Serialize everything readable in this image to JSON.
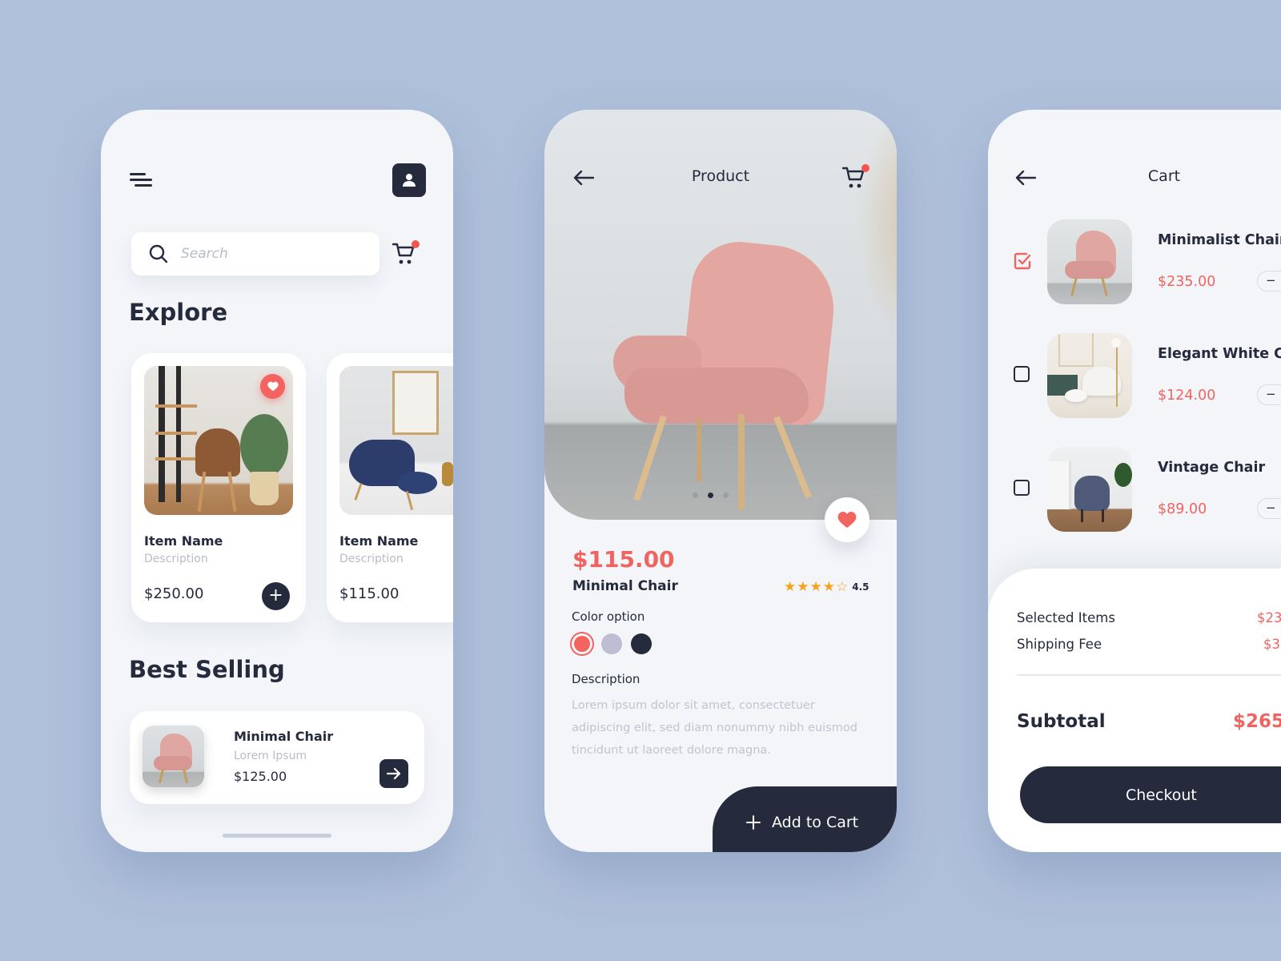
{
  "theme": {
    "background": "#afc0da",
    "screen": "#f3f5f9",
    "dark": "#252a3d",
    "accent": "#ef6461",
    "star": "#f6a31a"
  },
  "explore_screen": {
    "search": {
      "placeholder": "Search",
      "value": ""
    },
    "cart_has_badge": true,
    "explore_title": "Explore",
    "items": [
      {
        "name": "Item Name",
        "description": "Description",
        "price": "$250.00",
        "favorited": true,
        "image": "brown-leather-chair-with-shelf-and-plant"
      },
      {
        "name": "Item Name",
        "description": "Description",
        "price": "$115.00",
        "favorited": false,
        "image": "navy-lounge-chair-with-ottoman"
      }
    ],
    "best_selling_title": "Best Selling",
    "best_selling": [
      {
        "name": "Minimal Chair",
        "subtitle": "Lorem Ipsum",
        "price": "$125.00",
        "image": "pink-armchair"
      }
    ]
  },
  "product_screen": {
    "title": "Product",
    "cart_has_badge": true,
    "carousel": {
      "count": 3,
      "active": 2
    },
    "favorited": true,
    "price": "$115.00",
    "name": "Minimal Chair",
    "rating": {
      "value": "4.5",
      "filled_stars": 4,
      "total_stars": 5
    },
    "color_option_label": "Color option",
    "colors": [
      {
        "name": "coral",
        "hex": "#f36360",
        "selected": true
      },
      {
        "name": "lavender",
        "hex": "#bfbdd4",
        "selected": false
      },
      {
        "name": "navy",
        "hex": "#252a3d",
        "selected": false
      }
    ],
    "description_label": "Description",
    "description": "Lorem ipsum dolor sit amet, consectetuer adipiscing elit, sed diam nonummy nibh euismod tincidunt ut laoreet dolore magna.",
    "add_to_cart_label": "Add to Cart"
  },
  "cart_screen": {
    "title": "Cart",
    "items": [
      {
        "name": "Minimalist Chair",
        "price": "$235.00",
        "checked": true,
        "qty_minus": "−",
        "image": "pink-armchair"
      },
      {
        "name": "Elegant White Ch",
        "price": "$124.00",
        "checked": false,
        "qty_minus": "−",
        "image": "white-lounge-chair"
      },
      {
        "name": "Vintage Chair",
        "price": "$89.00",
        "checked": false,
        "qty_minus": "−",
        "image": "grey-rocking-chair"
      }
    ],
    "summary": {
      "selected_items_label": "Selected Items",
      "selected_items_value": "$23",
      "shipping_fee_label": "Shipping Fee",
      "shipping_fee_value": "$3",
      "subtotal_label": "Subtotal",
      "subtotal_value": "$265"
    },
    "checkout_label": "Checkout"
  }
}
